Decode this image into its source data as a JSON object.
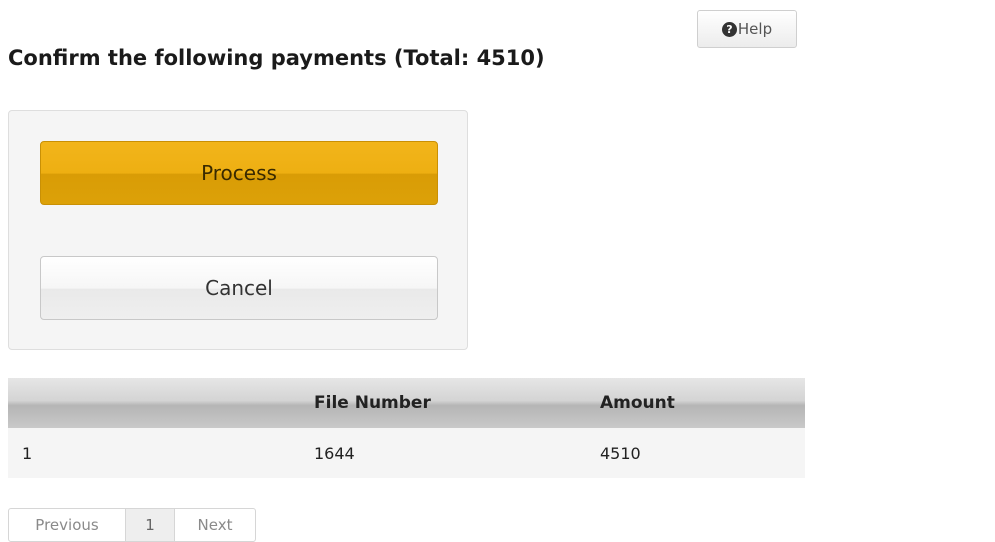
{
  "help": {
    "icon": "question-circle-icon",
    "icon_glyph": "?",
    "label": "Help"
  },
  "title": "Confirm the following payments (Total: 4510)",
  "actions": {
    "process_label": "Process",
    "cancel_label": "Cancel",
    "process_color": "#eeaf12"
  },
  "table": {
    "columns": [
      "",
      "File Number",
      "Amount"
    ],
    "rows": [
      [
        "1",
        "1644",
        "4510"
      ]
    ]
  },
  "pager": {
    "previous_label": "Previous",
    "current_page": "1",
    "next_label": "Next"
  }
}
